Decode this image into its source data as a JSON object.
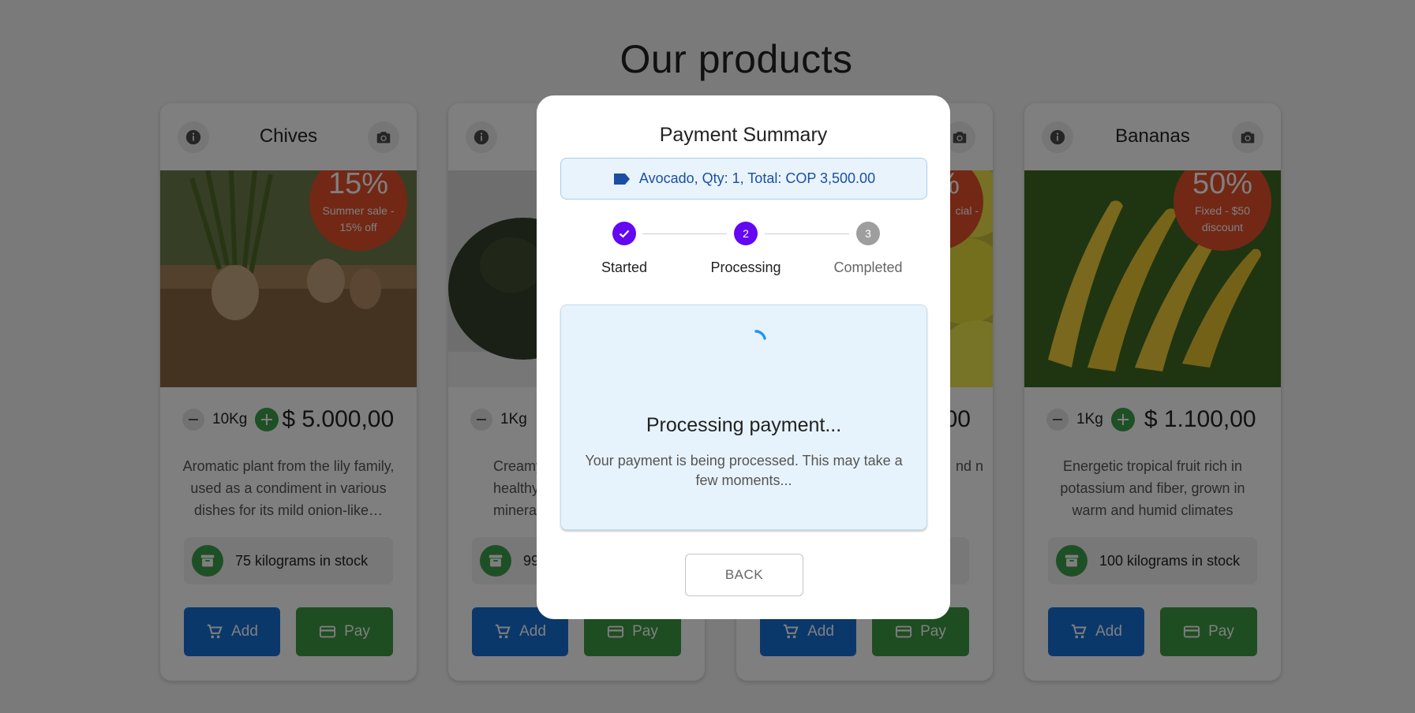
{
  "page": {
    "title": "Our products"
  },
  "cards": [
    {
      "name": "Chives",
      "discount_pct": "15%",
      "discount_desc": "Summer sale - 15% off",
      "qty": "10Kg",
      "price": "$ 5.000,00",
      "description": "Aromatic plant from the lily family, used as a condiment in various dishes for its mild onion-like…",
      "stock": "75 kilograms in stock",
      "add_label": "Add",
      "pay_label": "Pay"
    },
    {
      "name": "",
      "discount_pct": "",
      "discount_desc": "",
      "qty": "1Kg",
      "price": "",
      "description": "Creamy healthy minerals",
      "stock": "99",
      "add_label": "Add",
      "pay_label": "Pay"
    },
    {
      "name": "",
      "discount_pct": "%",
      "discount_desc": "cial -",
      "qty": "",
      "price": "00",
      "description": "nd n",
      "stock": "",
      "add_label": "Add",
      "pay_label": "Pay"
    },
    {
      "name": "Bananas",
      "discount_pct": "50%",
      "discount_desc": "Fixed - $50 discount",
      "qty": "1Kg",
      "price": "$ 1.100,00",
      "description": "Energetic tropical fruit rich in potassium and fiber, grown in warm and humid climates",
      "stock": "100 kilograms in stock",
      "add_label": "Add",
      "pay_label": "Pay"
    }
  ],
  "modal": {
    "title": "Payment Summary",
    "summary": "Avocado, Qty: 1, Total: COP 3,500.00",
    "steps": [
      {
        "number": "✓",
        "label": "Started",
        "state": "done"
      },
      {
        "number": "2",
        "label": "Processing",
        "state": "active"
      },
      {
        "number": "3",
        "label": "Completed",
        "state": "pending"
      }
    ],
    "processing_title": "Processing payment...",
    "processing_text": "Your payment is being processed. This may take a few moments...",
    "back_label": "BACK"
  },
  "colors": {
    "primary_blue": "#1670d6",
    "pay_green": "#3f9b45",
    "discount_orange": "#e4502a",
    "stepper_purple": "#6407f2",
    "spinner_blue": "#2196f3"
  },
  "icons": [
    "info-icon",
    "camera-icon",
    "minus-icon",
    "plus-icon",
    "archive-icon",
    "cart-icon",
    "credit-card-icon",
    "tag-icon",
    "check-icon",
    "spinner-icon"
  ]
}
